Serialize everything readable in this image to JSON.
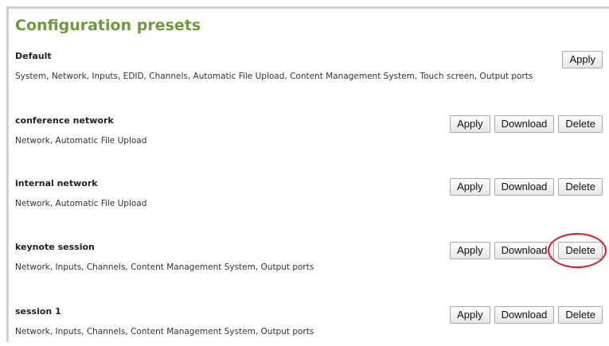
{
  "page": {
    "title": "Configuration presets"
  },
  "presets": [
    {
      "name": "Default",
      "description": "System, Network, Inputs, EDID, Channels, Automatic File Upload, Content Management System, Touch screen, Output ports",
      "apply_label": "Apply"
    },
    {
      "name": "conference network",
      "description": "Network, Automatic File Upload",
      "apply_label": "Apply",
      "download_label": "Download",
      "delete_label": "Delete"
    },
    {
      "name": "internal network",
      "description": "Network, Automatic File Upload",
      "apply_label": "Apply",
      "download_label": "Download",
      "delete_label": "Delete"
    },
    {
      "name": "keynote session",
      "description": "Network, Inputs, Channels, Content Management System, Output ports",
      "apply_label": "Apply",
      "download_label": "Download",
      "delete_label": "Delete",
      "delete_highlighted": true
    },
    {
      "name": "session 1",
      "description": "Network, Inputs, Channels, Content Management System, Output ports",
      "apply_label": "Apply",
      "download_label": "Download",
      "delete_label": "Delete"
    }
  ],
  "colors": {
    "title": "#6f9a3c",
    "highlight": "#e0192a"
  }
}
